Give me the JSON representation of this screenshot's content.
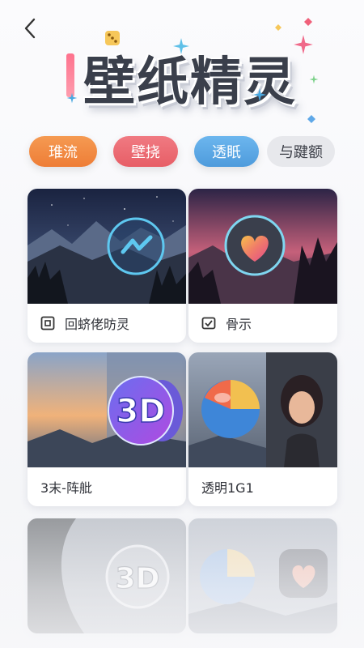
{
  "header": {
    "back_icon": "chevron-left-icon",
    "title": "壁纸精灵"
  },
  "tabs": [
    {
      "label": "琟流",
      "color": "#ee7d36"
    },
    {
      "label": "壁挠",
      "color": "#e75e66"
    },
    {
      "label": "透眂",
      "color": "#4e9bdc"
    },
    {
      "label": "与踺额",
      "color": "#e7e8ec"
    }
  ],
  "cards": [
    {
      "label": "回蛴佬昉灵",
      "icon": "qr-frame-icon",
      "thumb_icon": "messenger-icon"
    },
    {
      "label": "骨示",
      "icon": "mail-check-icon",
      "thumb_icon": "heart-icon"
    },
    {
      "label": "3末-阵舭",
      "thumb_icon": "3d-icon"
    },
    {
      "label": "透明1G1",
      "thumb_icon": "ball-icon"
    },
    {
      "label": "",
      "thumb_icon": "3d-icon"
    },
    {
      "label": "",
      "thumb_icon": "heart-icon"
    }
  ],
  "thumb_texts": {
    "three_d": "3D",
    "three_d_faded": "3D"
  },
  "colors": {
    "accent_orange": "#ee7d36",
    "accent_red": "#e75e66",
    "accent_blue": "#4e9bdc"
  }
}
